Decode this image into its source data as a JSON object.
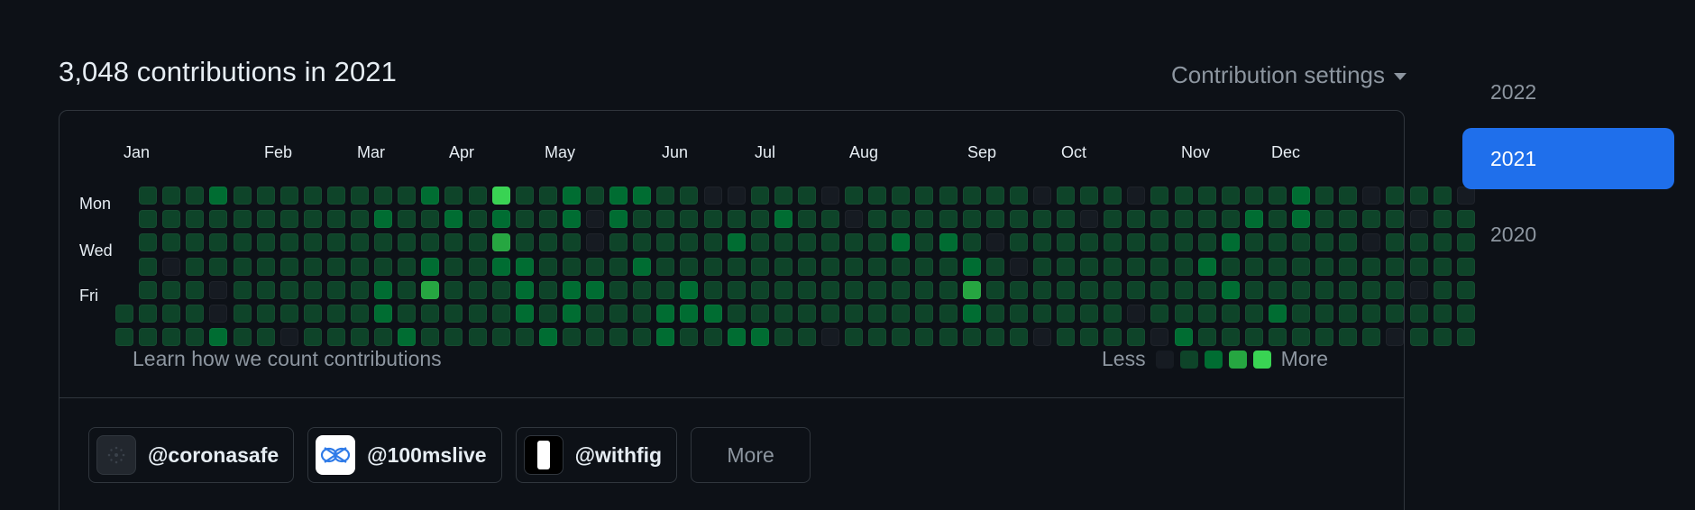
{
  "heading": "3,048 contributions in 2021",
  "settings_label": "Contribution settings",
  "months": [
    "Jan",
    "Feb",
    "Mar",
    "Apr",
    "May",
    "Jun",
    "Jul",
    "Aug",
    "Sep",
    "Oct",
    "Nov",
    "Dec"
  ],
  "day_labels": [
    "Mon",
    "Wed",
    "Fri"
  ],
  "learn_link": "Learn how we count contributions",
  "legend": {
    "less": "Less",
    "more": "More"
  },
  "colors": {
    "level0": "#161b22",
    "level1": "#0e4429",
    "level2": "#006d32",
    "level3": "#26a641",
    "level4": "#39d353",
    "accent": "#1f6feb"
  },
  "grid": {
    "rows": [
      "0111211111111211411212211001110111111110111011111121101110",
      "0111111111121121211202111111211011111111101111112121111011",
      "0111111111111111311101111121111112121011111111121111101111",
      "0101111111111211221111211111111111112101111111211111111111",
      "0111011111121311121221112111111111113111111111121111111011",
      "1111011111121111121211122211111111112111111011111211111111",
      "1111211011112111112111121122110111111110111102111111110111"
    ]
  },
  "orgs": [
    {
      "handle": "@coronasafe",
      "icon": "coronasafe-avatar"
    },
    {
      "handle": "@100mslive",
      "icon": "100mslive-avatar"
    },
    {
      "handle": "@withfig",
      "icon": "withfig-avatar"
    }
  ],
  "more_label": "More",
  "years": [
    {
      "label": "2022",
      "active": false
    },
    {
      "label": "2021",
      "active": true
    },
    {
      "label": "2020",
      "active": false
    }
  ]
}
